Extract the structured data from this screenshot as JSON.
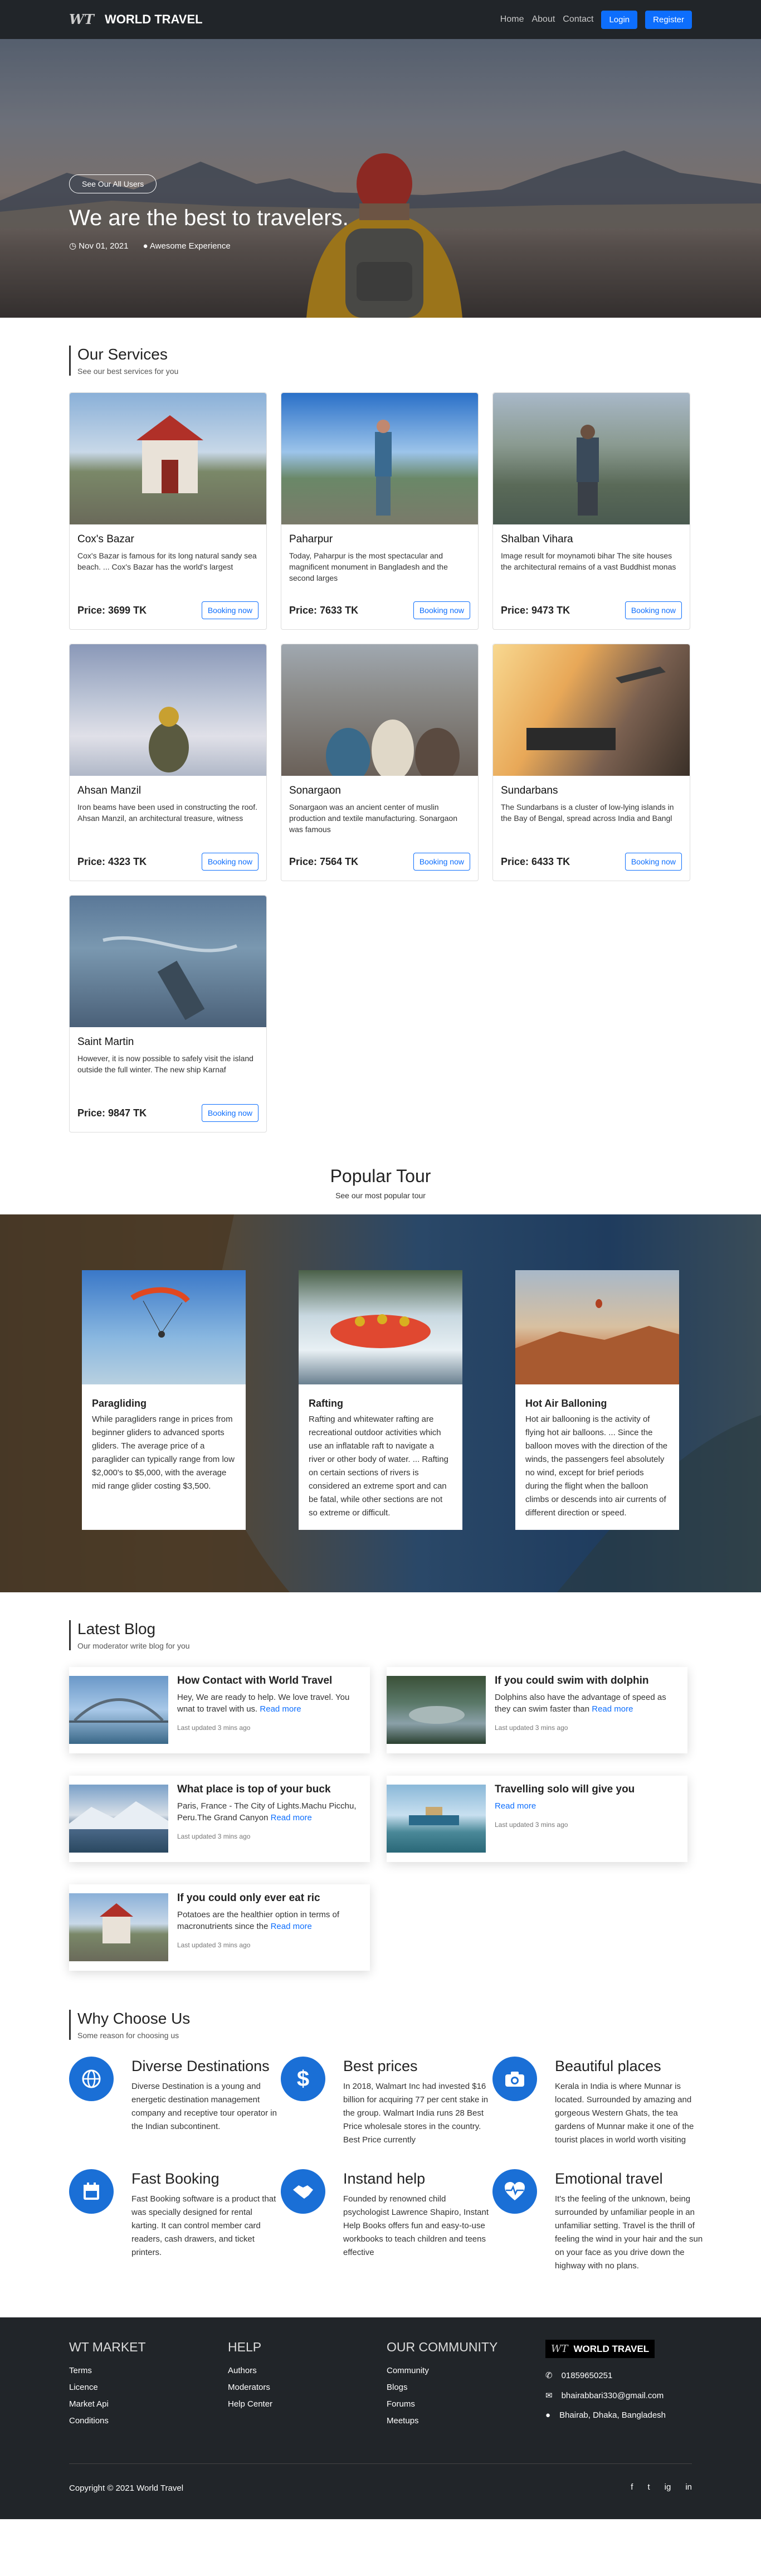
{
  "nav": {
    "logo_text": "WT",
    "brand": "WORLD TRAVEL",
    "links": [
      "Home",
      "About",
      "Contact"
    ],
    "login": "Login",
    "register": "Register"
  },
  "hero": {
    "button": "See Our All Users",
    "title": "We are the best to travelers.",
    "date": "Nov 01, 2021",
    "author": "Awesome Experience"
  },
  "services": {
    "title": "Our Services",
    "subtitle": "See our best services for you",
    "booking_label": "Booking now",
    "items": [
      {
        "name": "Cox's Bazar",
        "desc": "Cox's Bazar is famous for its long natural sandy sea beach. ... Cox's Bazar has the world's largest",
        "price": "Price: 3699 TK"
      },
      {
        "name": "Paharpur",
        "desc": "Today, Paharpur is the most spectacular and magnificent monument in Bangladesh and the second larges",
        "price": "Price: 7633 TK"
      },
      {
        "name": "Shalban Vihara",
        "desc": "Image result for moynamoti bihar The site houses the architectural remains of a vast Buddhist monas",
        "price": "Price: 9473 TK"
      },
      {
        "name": "Ahsan Manzil",
        "desc": "Iron beams have been used in constructing the roof. Ahsan Manzil, an architectural treasure, witness",
        "price": "Price: 4323 TK"
      },
      {
        "name": "Sonargaon",
        "desc": "Sonargaon was an ancient center of muslin production and textile manufacturing. Sonargaon was famous",
        "price": "Price: 7564 TK"
      },
      {
        "name": "Sundarbans",
        "desc": "The Sundarbans is a cluster of low-lying islands in the Bay of Bengal, spread across India and Bangl",
        "price": "Price: 6433 TK"
      },
      {
        "name": "Saint Martin",
        "desc": "However, it is now possible to safely visit the island outside the full winter. The new ship Karnaf",
        "price": "Price: 9847 TK"
      }
    ]
  },
  "popular": {
    "title": "Popular Tour",
    "subtitle": "See our most popular tour",
    "items": [
      {
        "name": "Paragliding",
        "desc": "While paragliders range in prices from beginner gliders to advanced sports gliders. The average price of a paraglider can typically range from low $2,000's to $5,000, with the average mid range glider costing $3,500."
      },
      {
        "name": "Rafting",
        "desc": "Rafting and whitewater rafting are recreational outdoor activities which use an inflatable raft to navigate a river or other body of water. ... Rafting on certain sections of rivers is considered an extreme sport and can be fatal, while other sections are not so extreme or difficult."
      },
      {
        "name": "Hot Air Balloning",
        "desc": "Hot air ballooning is the activity of flying hot air balloons. ... Since the balloon moves with the direction of the winds, the passengers feel absolutely no wind, except for brief periods during the flight when the balloon climbs or descends into air currents of different direction or speed."
      }
    ]
  },
  "blog": {
    "title": "Latest Blog",
    "subtitle": "Our moderator write blog for you",
    "read_more": "Read more",
    "items": [
      {
        "title": "How Contact with World Travel",
        "desc": "Hey, We are ready to help. We love travel. You wnat to travel with us.",
        "updated": "Last updated 3 mins ago"
      },
      {
        "title": "If you could swim with dolphin",
        "desc": "Dolphins also have the advantage of speed as they can swim faster than",
        "updated": "Last updated 3 mins ago"
      },
      {
        "title": "What place is top of your buck",
        "desc": "Paris, France - The City of Lights.Machu Picchu, Peru.The Grand Canyon",
        "updated": "Last updated 3 mins ago"
      },
      {
        "title": "Travelling solo will give you",
        "desc": "",
        "updated": "Last updated 3 mins ago"
      },
      {
        "title": "If you could only ever eat ric",
        "desc": "Potatoes are the healthier option in terms of macronutrients since the",
        "updated": "Last updated 3 mins ago"
      }
    ]
  },
  "why": {
    "title": "Why Choose Us",
    "subtitle": "Some reason for choosing us",
    "items": [
      {
        "icon": "globe-icon",
        "title": "Diverse Destinations",
        "desc": "Diverse Destination is a young and energetic destination management company and receptive tour operator in the Indian subcontinent."
      },
      {
        "icon": "dollar-icon",
        "title": "Best prices",
        "desc": "In 2018, Walmart Inc had invested $16 billion for acquiring 77 per cent stake in the group. Walmart India runs 28 Best Price wholesale stores in the country. Best Price currently"
      },
      {
        "icon": "camera-icon",
        "title": "Beautiful places",
        "desc": "Kerala in India is where Munnar is located. Surrounded by amazing and gorgeous Western Ghats, the tea gardens of Munnar make it one of the tourist places in world worth visiting"
      },
      {
        "icon": "calendar-icon",
        "title": "Fast Booking",
        "desc": "Fast Booking software is a product that was specially designed for rental karting. It can control member card readers, cash drawers, and ticket printers."
      },
      {
        "icon": "handshake-icon",
        "title": "Instand help",
        "desc": "Founded by renowned child psychologist Lawrence Shapiro, Instant Help Books offers fun and easy-to-use workbooks to teach children and teens effective"
      },
      {
        "icon": "heartbeat-icon",
        "title": "Emotional travel",
        "desc": "It's the feeling of the unknown, being surrounded by unfamiliar people in an unfamiliar setting. Travel is the thrill of feeling the wind in your hair and the sun on your face as you drive down the highway with no plans."
      }
    ]
  },
  "footer": {
    "col1_title": "WT MARKET",
    "col1": [
      "Terms",
      "Licence",
      "Market Api",
      "Conditions"
    ],
    "col2_title": "HELP",
    "col2": [
      "Authors",
      "Moderators",
      "Help Center"
    ],
    "col3_title": "OUR COMMUNITY",
    "col3": [
      "Community",
      "Blogs",
      "Forums",
      "Meetups"
    ],
    "logo_text": "WT",
    "brand": "WORLD TRAVEL",
    "phone": "01859650251",
    "email": "bhairabbari330@gmail.com",
    "address": "Bhairab, Dhaka, Bangladesh",
    "copyright": "Copyright © 2021 World Travel",
    "social": [
      "f",
      "t",
      "ig",
      "in"
    ]
  },
  "colors": {
    "primary": "#0d6efd",
    "dark": "#212529",
    "icon_circle": "#1a6fd6"
  }
}
